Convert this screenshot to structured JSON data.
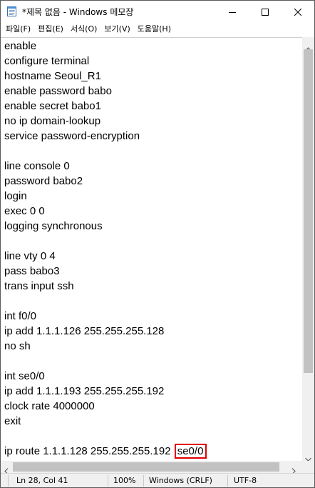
{
  "window": {
    "title": "*제목 없음 - Windows 메모장"
  },
  "menu": {
    "items": [
      "파일(F)",
      "편집(E)",
      "서식(O)",
      "보기(V)",
      "도움말(H)"
    ]
  },
  "editor": {
    "lines": [
      "enable",
      "configure terminal",
      "hostname Seoul_R1",
      "enable password babo",
      "enable secret babo1",
      "no ip domain-lookup",
      "service password-encryption",
      "",
      "line console 0",
      "password babo2",
      "login",
      "exec 0 0",
      "logging synchronous",
      "",
      "line vty 0 4",
      "pass babo3",
      "trans input ssh",
      "",
      "int f0/0",
      "ip add 1.1.1.126 255.255.255.128",
      "no sh",
      "",
      "int se0/0",
      "ip add 1.1.1.193 255.255.255.192",
      "clock rate 4000000",
      "exit",
      ""
    ],
    "last_line_prefix": "ip route 1.1.1.128 255.255.255.192",
    "last_line_highlighted": "se0/0",
    "highlight_color": "#e00000"
  },
  "statusbar": {
    "position": "Ln 28, Col 41",
    "zoom": "100%",
    "line_ending": "Windows (CRLF)",
    "encoding": "UTF-8"
  },
  "icons": {
    "app": "notepad-icon",
    "minimize": "minimize-icon",
    "maximize": "maximize-icon",
    "close": "close-icon"
  }
}
